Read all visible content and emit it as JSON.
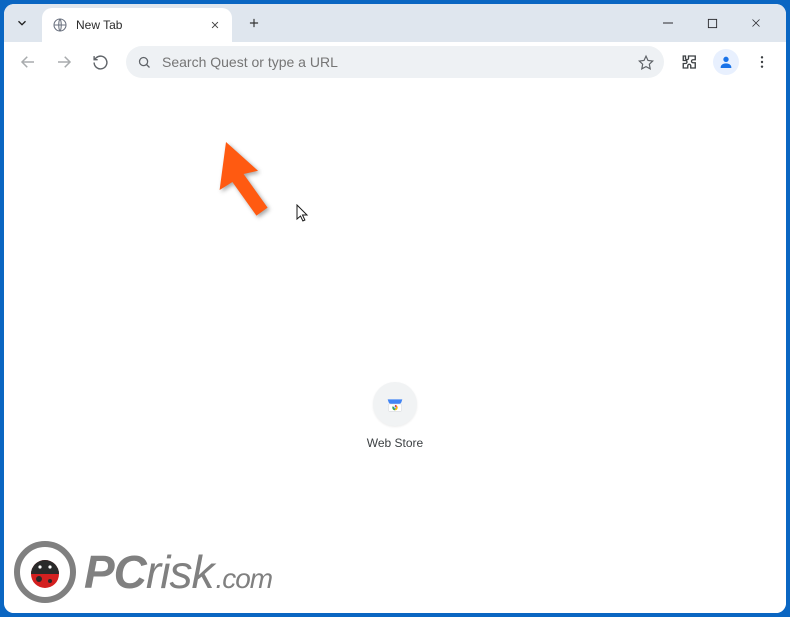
{
  "tab": {
    "title": "New Tab"
  },
  "omnibox": {
    "placeholder": "Search Quest or type a URL"
  },
  "shortcut": {
    "label": "Web Store"
  },
  "watermark": {
    "brand_left": "PC",
    "brand_right": "risk",
    "tld": ".com"
  }
}
